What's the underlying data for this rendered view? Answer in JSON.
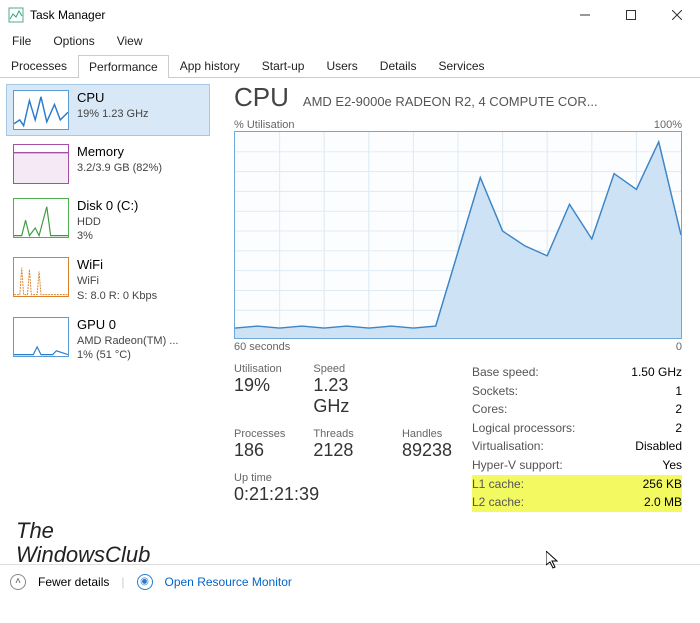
{
  "window": {
    "title": "Task Manager"
  },
  "menu": {
    "file": "File",
    "options": "Options",
    "view": "View"
  },
  "tabs": [
    "Processes",
    "Performance",
    "App history",
    "Start-up",
    "Users",
    "Details",
    "Services"
  ],
  "sidebar": {
    "cpu": {
      "title": "CPU",
      "l2": "19%  1.23 GHz",
      "l3": ""
    },
    "mem": {
      "title": "Memory",
      "l2": "3.2/3.9 GB (82%)",
      "l3": ""
    },
    "disk": {
      "title": "Disk 0 (C:)",
      "l2": "HDD",
      "l3": "3%"
    },
    "wifi": {
      "title": "WiFi",
      "l2": "WiFi",
      "l3": "S: 8.0  R: 0 Kbps"
    },
    "gpu": {
      "title": "GPU 0",
      "l2": "AMD Radeon(TM) ...",
      "l3": "1%  (51 °C)"
    }
  },
  "header": {
    "title": "CPU",
    "sub": "AMD E2-9000e RADEON R2, 4 COMPUTE COR..."
  },
  "chart_labels": {
    "tl": "% Utilisation",
    "tr": "100%",
    "bl": "60 seconds",
    "br": "0"
  },
  "stats": {
    "util_l": "Utilisation",
    "util_v": "19%",
    "speed_l": "Speed",
    "speed_v": "1.23 GHz",
    "proc_l": "Processes",
    "proc_v": "186",
    "thr_l": "Threads",
    "thr_v": "2128",
    "hnd_l": "Handles",
    "hnd_v": "89238",
    "upt_l": "Up time",
    "upt_v": "0:21:21:39"
  },
  "right": {
    "base_k": "Base speed:",
    "base_v": "1.50 GHz",
    "sock_k": "Sockets:",
    "sock_v": "1",
    "cores_k": "Cores:",
    "cores_v": "2",
    "lp_k": "Logical processors:",
    "lp_v": "2",
    "virt_k": "Virtualisation:",
    "virt_v": "Disabled",
    "hv_k": "Hyper-V support:",
    "hv_v": "Yes",
    "l1_k": "L1 cache:",
    "l1_v": "256 KB",
    "l2_k": "L2 cache:",
    "l2_v": "2.0 MB"
  },
  "footer": {
    "fewer": "Fewer details",
    "orm": "Open Resource Monitor"
  },
  "watermark": {
    "l1": "The",
    "l2": "WindowsClub"
  },
  "chart_data": {
    "type": "line",
    "title": "% Utilisation",
    "xlabel": "60 seconds",
    "ylabel": "",
    "ylim": [
      0,
      100
    ],
    "x_seconds_ago": [
      60,
      57,
      54,
      51,
      48,
      45,
      42,
      39,
      36,
      33,
      30,
      27,
      24,
      21,
      18,
      15,
      12,
      9,
      6,
      3,
      0
    ],
    "values": [
      5,
      6,
      5,
      6,
      5,
      6,
      5,
      6,
      5,
      6,
      42,
      78,
      52,
      45,
      40,
      65,
      48,
      80,
      72,
      95,
      50
    ]
  }
}
